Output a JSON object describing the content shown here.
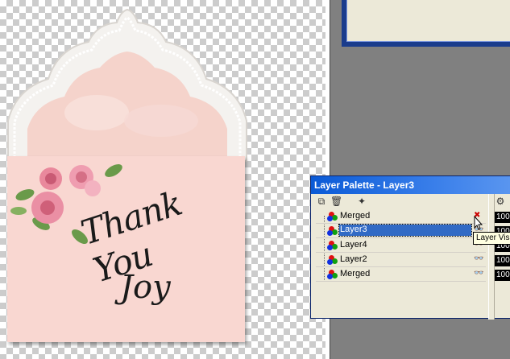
{
  "palette": {
    "title": "Layer Palette - Layer3",
    "layers": [
      {
        "name": "Merged",
        "selected": false
      },
      {
        "name": "Layer3",
        "selected": true
      },
      {
        "name": "Layer4",
        "selected": false
      },
      {
        "name": "Layer2",
        "selected": false
      },
      {
        "name": "Merged",
        "selected": false
      }
    ],
    "opacity_values": [
      "100",
      "100",
      "100",
      "100",
      "100"
    ],
    "tooltip": "Layer Vis"
  },
  "card": {
    "line1": "Thank You",
    "line2": "Joy"
  },
  "colors": {
    "card": "#f9d7d1",
    "selection": "#316ac5",
    "titlebar": "#0a5ad6"
  }
}
